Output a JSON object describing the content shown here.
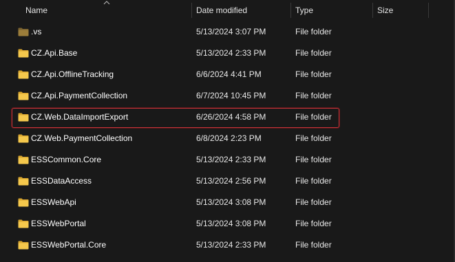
{
  "columns": {
    "name": "Name",
    "date_modified": "Date modified",
    "type": "Type",
    "size": "Size"
  },
  "sort": {
    "column": "Name",
    "icon": "chevron-up-icon"
  },
  "colors": {
    "background": "#191919",
    "folder": "#f5c84c",
    "folder_dark": "#d9a62f",
    "vs_folder": "#9b7d3a",
    "selection_border": "#c7343a"
  },
  "rows": [
    {
      "name": ".vs",
      "date": "5/13/2024 3:07 PM",
      "type": "File folder",
      "size": "",
      "hidden": true
    },
    {
      "name": "CZ.Api.Base",
      "date": "5/13/2024 2:33 PM",
      "type": "File folder",
      "size": ""
    },
    {
      "name": "CZ.Api.OfflineTracking",
      "date": "6/6/2024 4:41 PM",
      "type": "File folder",
      "size": ""
    },
    {
      "name": "CZ.Api.PaymentCollection",
      "date": "6/7/2024 10:45 PM",
      "type": "File folder",
      "size": ""
    },
    {
      "name": "CZ.Web.DataImportExport",
      "date": "6/26/2024 4:58 PM",
      "type": "File folder",
      "size": "",
      "highlighted": true
    },
    {
      "name": "CZ.Web.PaymentCollection",
      "date": "6/8/2024 2:23 PM",
      "type": "File folder",
      "size": ""
    },
    {
      "name": "ESSCommon.Core",
      "date": "5/13/2024 2:33 PM",
      "type": "File folder",
      "size": ""
    },
    {
      "name": "ESSDataAccess",
      "date": "5/13/2024 2:56 PM",
      "type": "File folder",
      "size": ""
    },
    {
      "name": "ESSWebApi",
      "date": "5/13/2024 3:08 PM",
      "type": "File folder",
      "size": ""
    },
    {
      "name": "ESSWebPortal",
      "date": "5/13/2024 3:08 PM",
      "type": "File folder",
      "size": ""
    },
    {
      "name": "ESSWebPortal.Core",
      "date": "5/13/2024 2:33 PM",
      "type": "File folder",
      "size": ""
    }
  ]
}
